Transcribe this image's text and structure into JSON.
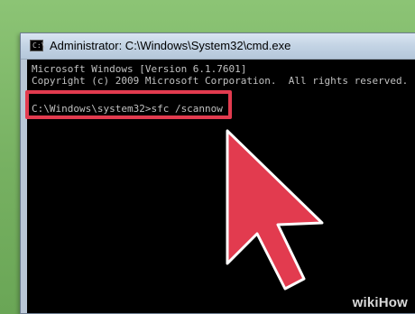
{
  "window": {
    "title": "Administrator: C:\\Windows\\System32\\cmd.exe",
    "icon": "cmd-icon"
  },
  "console": {
    "lines": [
      "Microsoft Windows [Version 6.1.7601]",
      "Copyright (c) 2009 Microsoft Corporation.  All rights reserved.",
      "C:\\Windows\\system32>sfc /scannow"
    ]
  },
  "annotation": {
    "highlight_color": "#e23b4f",
    "arrow_color": "#e23b4f",
    "arrow_icon": "pointer-arrow-icon"
  },
  "watermark": "wikiHow"
}
